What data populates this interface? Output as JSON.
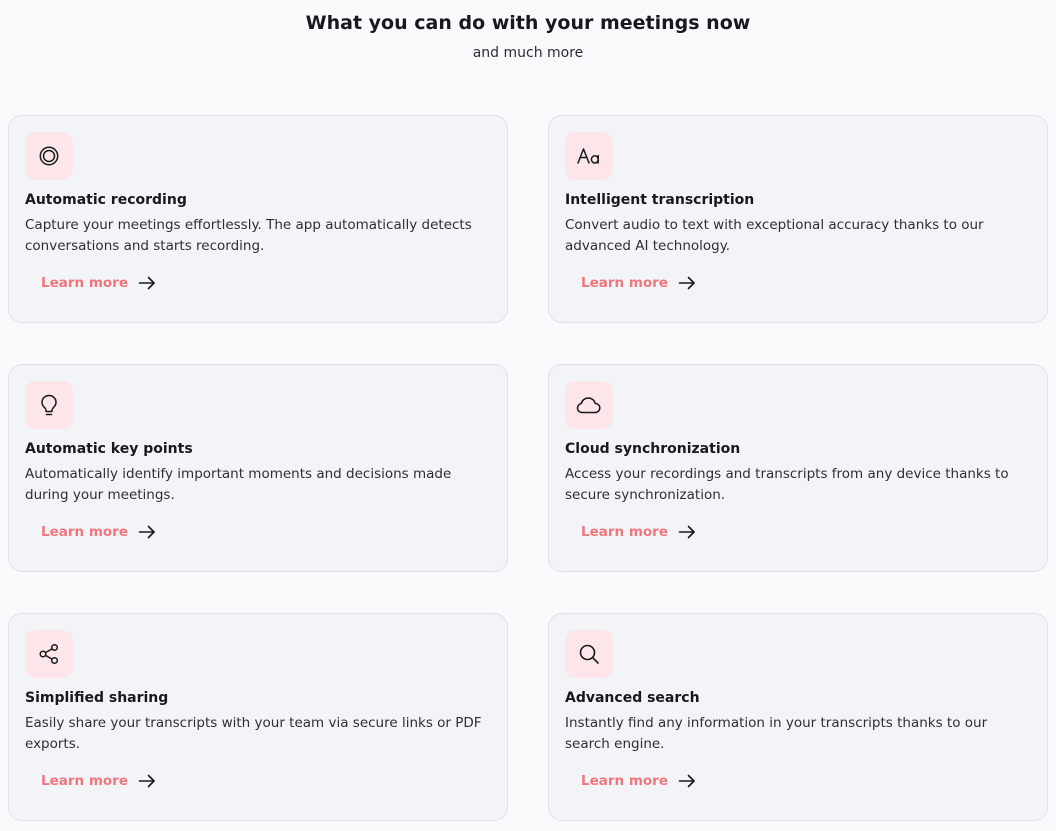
{
  "header": {
    "title": "What you can do with your meetings now",
    "subtitle": "and much more"
  },
  "colors": {
    "accent": "#f0767e",
    "icon_bg": "#fde6ea",
    "card_bg": "#f3f4f7",
    "page_bg": "#f9fafc"
  },
  "features": [
    {
      "icon": "record-icon",
      "title": "Automatic recording",
      "description": "Capture your meetings effortlessly. The app automatically detects conversations and starts recording.",
      "link_label": "Learn more"
    },
    {
      "icon": "text-aa-icon",
      "title": "Intelligent transcription",
      "description": "Convert audio to text with exceptional accuracy thanks to our advanced AI technology.",
      "link_label": "Learn more"
    },
    {
      "icon": "lightbulb-icon",
      "title": "Automatic key points",
      "description": "Automatically identify important moments and decisions made during your meetings.",
      "link_label": "Learn more"
    },
    {
      "icon": "cloud-icon",
      "title": "Cloud synchronization",
      "description": "Access your recordings and transcripts from any device thanks to secure synchronization.",
      "link_label": "Learn more"
    },
    {
      "icon": "share-icon",
      "title": "Simplified sharing",
      "description": "Easily share your transcripts with your team via secure links or PDF exports.",
      "link_label": "Learn more"
    },
    {
      "icon": "search-icon",
      "title": "Advanced search",
      "description": "Instantly find any information in your transcripts thanks to our search engine.",
      "link_label": "Learn more"
    }
  ]
}
